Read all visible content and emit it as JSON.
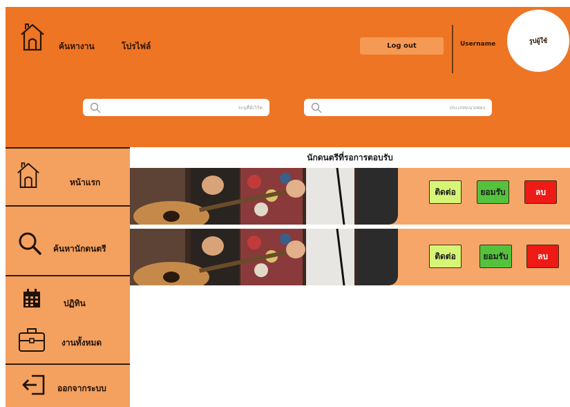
{
  "header": {
    "nav_jobs": "ค้นหางาน",
    "nav_profile": "โปรไฟล์",
    "logout_label": "Log out",
    "username": "Username",
    "avatar_label": "รูปผู้ใช้"
  },
  "search": {
    "first_placeholder": "ระบุคีย์เวิร์ด",
    "second_placeholder": "ประเภทแนวเพลง"
  },
  "sidebar": {
    "items": [
      {
        "label": "หน้าแรก",
        "icon": "home-icon"
      },
      {
        "label": "ค้นหานักดนตรี",
        "icon": "search-icon"
      },
      {
        "label": "ปฏิทิน",
        "icon": "calendar-icon"
      },
      {
        "label": "งานทั้งหมด",
        "icon": "briefcase-icon"
      },
      {
        "label": "ออกจากระบบ",
        "icon": "logout-icon"
      }
    ]
  },
  "main": {
    "title": "นักดนตรีที่รอการตอบรับ",
    "rows": [
      {
        "contact": "ติดต่อ",
        "accept": "ยอมรับ",
        "delete": "ลบ"
      },
      {
        "contact": "ติดต่อ",
        "accept": "ยอมรับ",
        "delete": "ลบ"
      }
    ]
  },
  "colors": {
    "header_bg": "#ee7524",
    "sidebar_bg": "#f4a05f",
    "row_bg": "#f6a668",
    "contact_btn": "#d6f576",
    "accept_btn": "#55c23d",
    "delete_btn": "#ee1a16"
  }
}
